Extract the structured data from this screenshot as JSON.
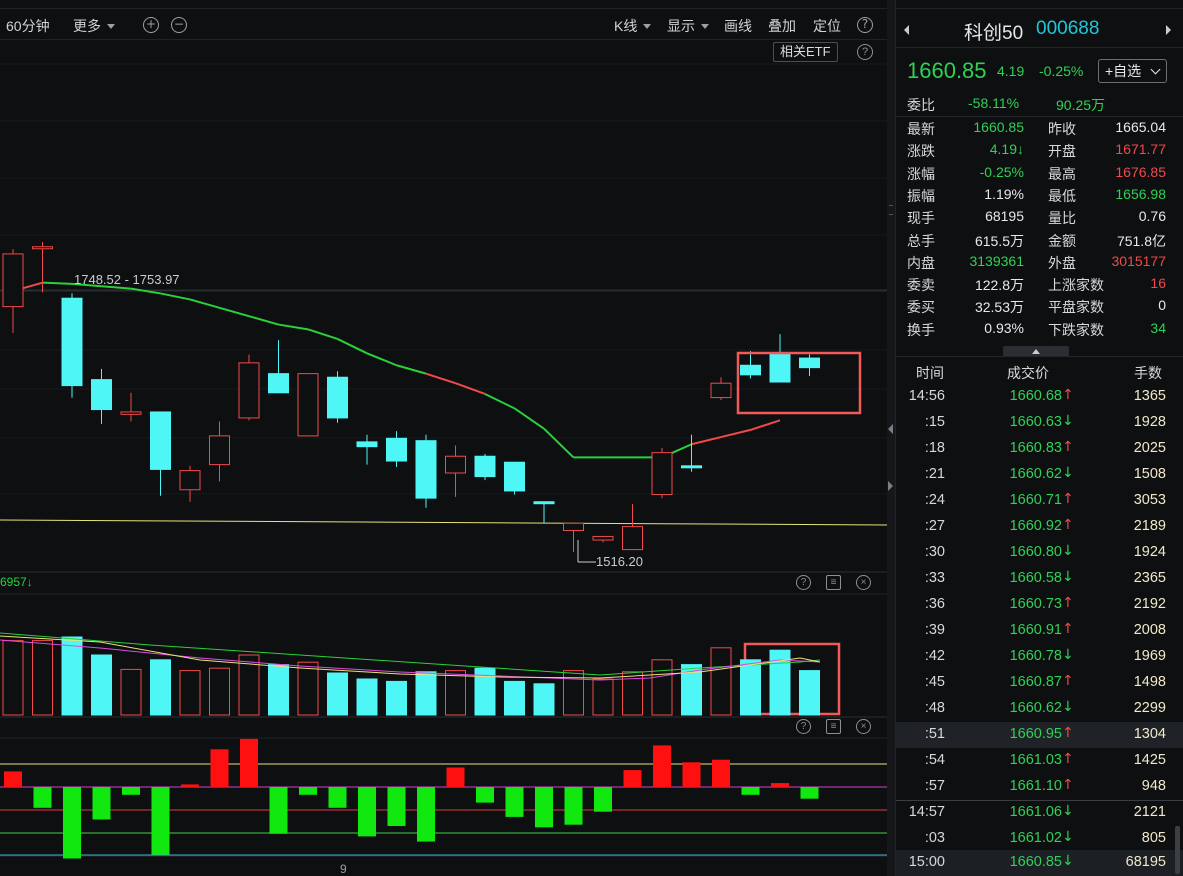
{
  "toolbar": {
    "period": "60分钟",
    "more": "更多",
    "kline": "K线",
    "display": "显示",
    "draw": "画线",
    "overlay": "叠加",
    "locate": "定位",
    "etf": "相关ETF",
    "help": "?",
    "zoom_in": "+",
    "zoom_out": "−"
  },
  "chart": {
    "high_label": "1748.52 - 1753.97",
    "low_label": "1516.20",
    "indicator_text": "6957↓",
    "x_tick": "9"
  },
  "chart_data": {
    "type": "candlestick",
    "title": "",
    "candles": [
      {
        "o": 1700.0,
        "h": 1748.0,
        "l": 1678.0,
        "c": 1744.0,
        "dir": "up"
      },
      {
        "o": 1750.0,
        "h": 1753.97,
        "l": 1712.0,
        "c": 1749.0,
        "dir": "up"
      },
      {
        "o": 1707.0,
        "h": 1711.0,
        "l": 1624.0,
        "c": 1634.0,
        "dir": "down"
      },
      {
        "o": 1639.0,
        "h": 1648.0,
        "l": 1602.0,
        "c": 1614.0,
        "dir": "down"
      },
      {
        "o": 1612.0,
        "h": 1628.0,
        "l": 1604.0,
        "c": 1610.0,
        "dir": "up"
      },
      {
        "o": 1612.0,
        "h": 1612.0,
        "l": 1542.0,
        "c": 1564.0,
        "dir": "down"
      },
      {
        "o": 1547.0,
        "h": 1567.0,
        "l": 1537.0,
        "c": 1563.0,
        "dir": "up"
      },
      {
        "o": 1568.0,
        "h": 1604.0,
        "l": 1554.0,
        "c": 1592.0,
        "dir": "up"
      },
      {
        "o": 1607.0,
        "h": 1660.0,
        "l": 1605.0,
        "c": 1653.0,
        "dir": "up"
      },
      {
        "o": 1644.0,
        "h": 1672.0,
        "l": 1628.0,
        "c": 1628.0,
        "dir": "down"
      },
      {
        "o": 1592.0,
        "h": 1644.0,
        "l": 1592.0,
        "c": 1644.0,
        "dir": "up"
      },
      {
        "o": 1641.0,
        "h": 1646.0,
        "l": 1603.0,
        "c": 1607.0,
        "dir": "down"
      },
      {
        "o": 1587.0,
        "h": 1593.0,
        "l": 1568.0,
        "c": 1583.0,
        "dir": "down"
      },
      {
        "o": 1590.0,
        "h": 1596.0,
        "l": 1566.0,
        "c": 1571.0,
        "dir": "down"
      },
      {
        "o": 1588.0,
        "h": 1593.0,
        "l": 1532.0,
        "c": 1540.0,
        "dir": "down"
      },
      {
        "o": 1561.0,
        "h": 1584.0,
        "l": 1541.0,
        "c": 1575.0,
        "dir": "up"
      },
      {
        "o": 1575.0,
        "h": 1577.0,
        "l": 1555.0,
        "c": 1558.0,
        "dir": "down"
      },
      {
        "o": 1570.0,
        "h": 1570.0,
        "l": 1543.0,
        "c": 1546.0,
        "dir": "down"
      },
      {
        "o": 1537.0,
        "h": 1537.0,
        "l": 1519.0,
        "c": 1537.0,
        "dir": "down"
      },
      {
        "o": 1519.0,
        "h": 1519.0,
        "l": 1495.0,
        "c": 1513.0,
        "dir": "up"
      },
      {
        "o": 1508.0,
        "h": 1508.0,
        "l": 1503.0,
        "c": 1505.0,
        "dir": "up"
      },
      {
        "o": 1497.0,
        "h": 1535.0,
        "l": 1497.0,
        "c": 1516.2,
        "dir": "up"
      },
      {
        "o": 1543.0,
        "h": 1582.0,
        "l": 1540.0,
        "c": 1578.0,
        "dir": "up"
      },
      {
        "o": 1566.0,
        "h": 1593.0,
        "l": 1562.0,
        "c": 1567.0,
        "dir": "down"
      },
      {
        "o": 1624.0,
        "h": 1641.0,
        "l": 1622.0,
        "c": 1636.0,
        "dir": "up"
      },
      {
        "o": 1651.0,
        "h": 1663.0,
        "l": 1640.0,
        "c": 1643.0,
        "dir": "down"
      },
      {
        "o": 1661.0,
        "h": 1677.0,
        "l": 1658.0,
        "c": 1637.0,
        "dir": "down"
      },
      {
        "o": 1657.0,
        "h": 1660.0,
        "l": 1642.0,
        "c": 1649.0,
        "dir": "down"
      }
    ],
    "ma_short": [
      1713,
      1720,
      1719,
      1717,
      1715,
      1711,
      1706,
      1699,
      1692,
      1685,
      1681,
      1673,
      1661,
      1651,
      1644,
      1636,
      1627,
      1615,
      1598,
      1574,
      1574,
      1574,
      1574,
      1585,
      1591,
      1597,
      1605
    ],
    "ma_long_level": 1530
  },
  "volume_chart": {
    "bars": [
      {
        "v": 6.2,
        "dir": "up"
      },
      {
        "v": 6.2,
        "dir": "up"
      },
      {
        "v": 6.5,
        "dir": "down"
      },
      {
        "v": 5.0,
        "dir": "down"
      },
      {
        "v": 3.8,
        "dir": "up"
      },
      {
        "v": 4.6,
        "dir": "down"
      },
      {
        "v": 3.7,
        "dir": "up"
      },
      {
        "v": 3.9,
        "dir": "up"
      },
      {
        "v": 5.0,
        "dir": "up"
      },
      {
        "v": 4.2,
        "dir": "down"
      },
      {
        "v": 4.4,
        "dir": "up"
      },
      {
        "v": 3.5,
        "dir": "down"
      },
      {
        "v": 3.0,
        "dir": "down"
      },
      {
        "v": 2.8,
        "dir": "down"
      },
      {
        "v": 3.6,
        "dir": "down"
      },
      {
        "v": 3.7,
        "dir": "up"
      },
      {
        "v": 3.9,
        "dir": "down"
      },
      {
        "v": 2.8,
        "dir": "down"
      },
      {
        "v": 2.6,
        "dir": "down"
      },
      {
        "v": 3.7,
        "dir": "up"
      },
      {
        "v": 3.0,
        "dir": "up"
      },
      {
        "v": 3.6,
        "dir": "up"
      },
      {
        "v": 4.6,
        "dir": "up"
      },
      {
        "v": 4.2,
        "dir": "down"
      },
      {
        "v": 5.6,
        "dir": "up"
      },
      {
        "v": 4.6,
        "dir": "down"
      },
      {
        "v": 5.4,
        "dir": "down"
      },
      {
        "v": 3.7,
        "dir": "down"
      }
    ]
  },
  "macd_chart": {
    "bars": [
      1.2,
      -1.6,
      -5.5,
      -2.5,
      -0.6,
      -5.2,
      0.2,
      2.9,
      3.7,
      -3.6,
      -0.6,
      -1.6,
      -3.8,
      -3.0,
      -4.2,
      1.5,
      -1.2,
      -2.3,
      -3.1,
      -2.9,
      -1.9,
      1.3,
      3.2,
      1.9,
      2.1,
      -0.6,
      0.3,
      -0.9
    ]
  },
  "quote": {
    "name": "科创50",
    "code": "000688",
    "price": "1660.85",
    "change": "4.19",
    "pct": "-0.25%",
    "watch": "+自选",
    "ratio_label": "委比",
    "ratio_pct": "-58.11%",
    "ratio_amount": "90.25万",
    "stats": [
      {
        "l1": "最新",
        "v1": "1660.85",
        "c1": "v-green",
        "l2": "昨收",
        "v2": "1665.04",
        "c2": "v-white"
      },
      {
        "l1": "涨跌",
        "v1": "4.19↓",
        "c1": "v-green",
        "l2": "开盘",
        "v2": "1671.77",
        "c2": "v-red"
      },
      {
        "l1": "涨幅",
        "v1": "-0.25%",
        "c1": "v-green",
        "l2": "最高",
        "v2": "1676.85",
        "c2": "v-red"
      },
      {
        "l1": "振幅",
        "v1": "1.19%",
        "c1": "v-white",
        "l2": "最低",
        "v2": "1656.98",
        "c2": "v-green"
      },
      {
        "l1": "现手",
        "v1": "68195",
        "c1": "v-white",
        "l2": "量比",
        "v2": "0.76",
        "c2": "v-white"
      },
      {
        "l1": "总手",
        "v1": "615.5万",
        "c1": "v-white",
        "l2": "金额",
        "v2": "751.8亿",
        "c2": "v-white"
      },
      {
        "l1": "内盘",
        "v1": "3139361",
        "c1": "v-green",
        "l2": "外盘",
        "v2": "3015177",
        "c2": "v-red"
      },
      {
        "l1": "委卖",
        "v1": "122.8万",
        "c1": "v-white",
        "l2": "上涨家数",
        "v2": "16",
        "c2": "v-red"
      },
      {
        "l1": "委买",
        "v1": "32.53万",
        "c1": "v-white",
        "l2": "平盘家数",
        "v2": "0",
        "c2": "v-white"
      },
      {
        "l1": "换手",
        "v1": "0.93%",
        "c1": "v-white",
        "l2": "下跌家数",
        "v2": "34",
        "c2": "v-green"
      }
    ],
    "tick_header": {
      "time": "时间",
      "price": "成交价",
      "vol": "手数"
    },
    "ticks": [
      {
        "t": "14:56",
        "p": "1660.68",
        "d": "↑",
        "dir": "up",
        "v": "1365"
      },
      {
        "t": ":15",
        "p": "1660.63",
        "d": "↓",
        "dir": "down",
        "v": "1928"
      },
      {
        "t": ":18",
        "p": "1660.83",
        "d": "↑",
        "dir": "up",
        "v": "2025"
      },
      {
        "t": ":21",
        "p": "1660.62",
        "d": "↓",
        "dir": "down",
        "v": "1508"
      },
      {
        "t": ":24",
        "p": "1660.71",
        "d": "↑",
        "dir": "up",
        "v": "3053"
      },
      {
        "t": ":27",
        "p": "1660.92",
        "d": "↑",
        "dir": "up",
        "v": "2189"
      },
      {
        "t": ":30",
        "p": "1660.80",
        "d": "↓",
        "dir": "down",
        "v": "1924"
      },
      {
        "t": ":33",
        "p": "1660.58",
        "d": "↓",
        "dir": "down",
        "v": "2365"
      },
      {
        "t": ":36",
        "p": "1660.73",
        "d": "↑",
        "dir": "up",
        "v": "2192"
      },
      {
        "t": ":39",
        "p": "1660.91",
        "d": "↑",
        "dir": "up",
        "v": "2008"
      },
      {
        "t": ":42",
        "p": "1660.78",
        "d": "↓",
        "dir": "down",
        "v": "1969"
      },
      {
        "t": ":45",
        "p": "1660.87",
        "d": "↑",
        "dir": "up",
        "v": "1498"
      },
      {
        "t": ":48",
        "p": "1660.62",
        "d": "↓",
        "dir": "down",
        "v": "2299"
      },
      {
        "t": ":51",
        "p": "1660.95",
        "d": "↑",
        "dir": "up",
        "v": "1304"
      },
      {
        "t": ":54",
        "p": "1661.03",
        "d": "↑",
        "dir": "up",
        "v": "1425"
      },
      {
        "t": ":57",
        "p": "1661.10",
        "d": "↑",
        "dir": "up",
        "v": "948"
      },
      {
        "t": "14:57",
        "p": "1661.06",
        "d": "↓",
        "dir": "down",
        "v": "2121"
      },
      {
        "t": ":03",
        "p": "1661.02",
        "d": "↓",
        "dir": "down",
        "v": "805"
      },
      {
        "t": "15:00",
        "p": "1660.85",
        "d": "↓",
        "dir": "down",
        "v": "68195"
      }
    ],
    "highlight_row": 13
  },
  "colors": {
    "up": "#f04a4a",
    "down": "#4ef6f6",
    "green": "#2fd156",
    "accent": "#1fc7d8",
    "box": "#f05a5a"
  }
}
